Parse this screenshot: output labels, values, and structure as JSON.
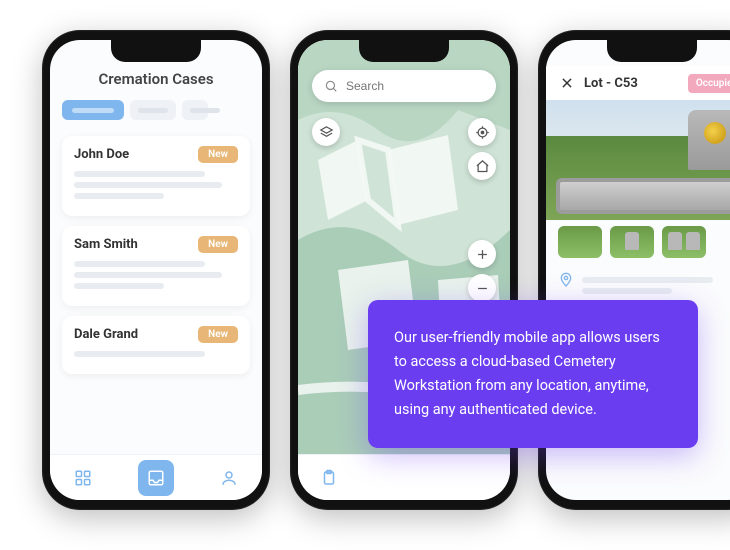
{
  "phone1": {
    "header_title": "Cremation Cases",
    "cases": [
      {
        "name": "John Doe",
        "badge": "New"
      },
      {
        "name": "Sam Smith",
        "badge": "New"
      },
      {
        "name": "Dale Grand",
        "badge": "New"
      }
    ]
  },
  "phone2": {
    "search_placeholder": "Search",
    "icons": {
      "search": "search-icon",
      "mic": "mic-icon",
      "layers": "layers-icon",
      "locate": "locate-icon",
      "home": "home-icon",
      "plus": "plus-icon",
      "minus": "minus-icon"
    }
  },
  "phone3": {
    "lot_title": "Lot - C53",
    "lot_status": "Occupied"
  },
  "callout_text": "Our user-friendly mobile app allows users to access a cloud-based Cemetery Workstation from any location, anytime, using any authenticated device.",
  "colors": {
    "accent": "#6b3df0",
    "blue": "#7fb6ed",
    "tan": "#e8b777",
    "pink": "#f3a9bd"
  }
}
